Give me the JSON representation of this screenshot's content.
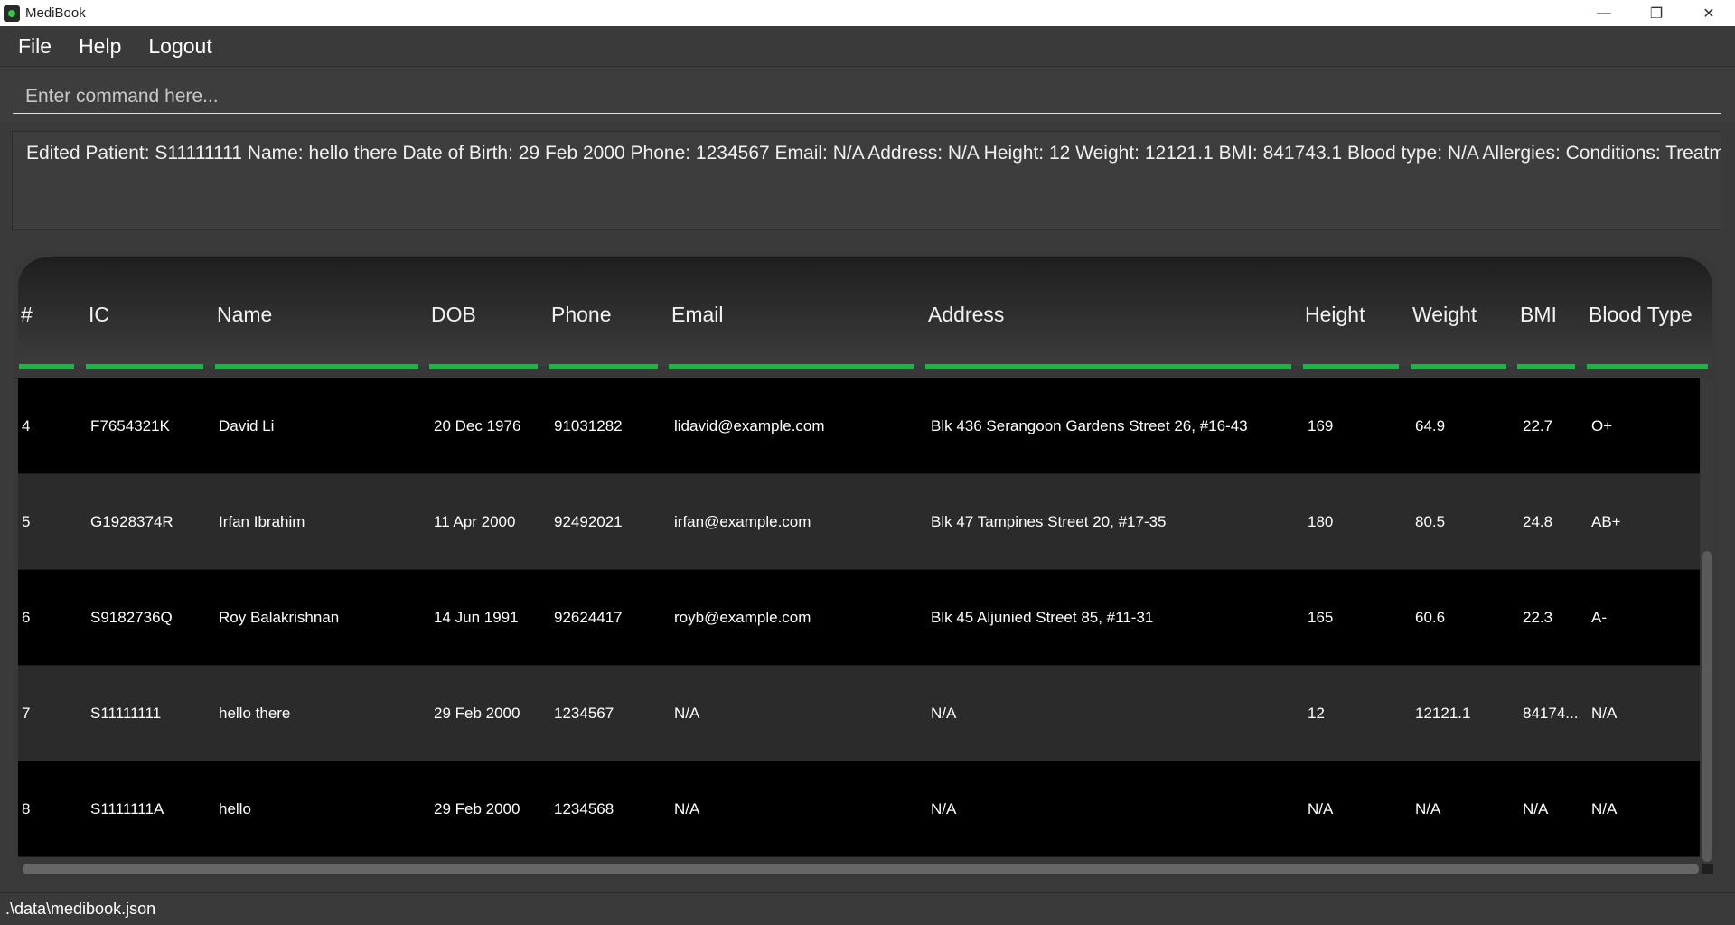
{
  "window": {
    "title": "MediBook",
    "minimize": "—",
    "restore": "❐",
    "close": "✕"
  },
  "menu": {
    "file": "File",
    "help": "Help",
    "logout": "Logout"
  },
  "command": {
    "placeholder": "Enter command here...",
    "value": ""
  },
  "result": {
    "text": "Edited Patient: S11111111 Name: hello there Date of Birth: 29 Feb 2000 Phone: 1234567 Email: N/A Address: N/A Height: 12 Weight: 12121.1 BMI: 841743.1 Blood type: N/A Allergies:  Conditions:  Treatments:"
  },
  "table": {
    "headers": {
      "index": "#",
      "ic": "IC",
      "name": "Name",
      "dob": "DOB",
      "phone": "Phone",
      "email": "Email",
      "address": "Address",
      "height": "Height",
      "weight": "Weight",
      "bmi": "BMI",
      "blood": "Blood Type"
    },
    "rows": [
      {
        "index": "4",
        "ic": "F7654321K",
        "name": "David Li",
        "dob": "20 Dec 1976",
        "phone": "91031282",
        "email": "lidavid@example.com",
        "address": "Blk 436 Serangoon Gardens Street 26, #16-43",
        "height": "169",
        "weight": "64.9",
        "bmi": "22.7",
        "blood": "O+"
      },
      {
        "index": "5",
        "ic": "G1928374R",
        "name": "Irfan Ibrahim",
        "dob": "11 Apr 2000",
        "phone": "92492021",
        "email": "irfan@example.com",
        "address": "Blk 47 Tampines Street 20, #17-35",
        "height": "180",
        "weight": "80.5",
        "bmi": "24.8",
        "blood": "AB+"
      },
      {
        "index": "6",
        "ic": "S9182736Q",
        "name": "Roy Balakrishnan",
        "dob": "14 Jun 1991",
        "phone": "92624417",
        "email": "royb@example.com",
        "address": "Blk 45 Aljunied Street 85, #11-31",
        "height": "165",
        "weight": "60.6",
        "bmi": "22.3",
        "blood": "A-"
      },
      {
        "index": "7",
        "ic": "S11111111",
        "name": "hello there",
        "dob": "29 Feb 2000",
        "phone": "1234567",
        "email": "N/A",
        "address": "N/A",
        "height": "12",
        "weight": "12121.1",
        "bmi": "84174...",
        "blood": "N/A"
      },
      {
        "index": "8",
        "ic": "S1111111A",
        "name": "hello",
        "dob": "29 Feb 2000",
        "phone": "1234568",
        "email": "N/A",
        "address": "N/A",
        "height": "N/A",
        "weight": "N/A",
        "bmi": "N/A",
        "blood": "N/A"
      }
    ]
  },
  "status": {
    "file_path": ".\\data\\medibook.json"
  },
  "colors": {
    "accent": "#22b04a",
    "background": "#3a3a3a",
    "row_dark": "#000000",
    "row_light": "#2b2b2b"
  }
}
